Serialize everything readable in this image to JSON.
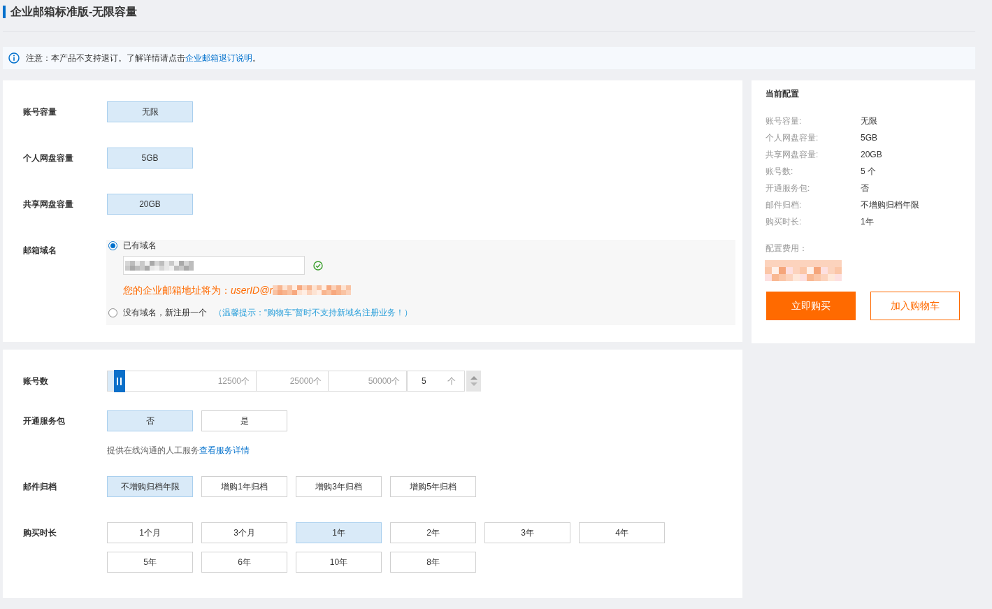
{
  "title": "企业邮箱标准版-无限容量",
  "notice": {
    "text": "注意：本产品不支持退订。了解详情请点击",
    "link": "企业邮箱退订说明",
    "text_after": "。"
  },
  "spec_form": {
    "rows": [
      {
        "kind": "options",
        "label": "账号容量",
        "options": [
          {
            "label": "无限",
            "selected": true
          }
        ]
      },
      {
        "kind": "options",
        "label": "个人网盘容量",
        "options": [
          {
            "label": "5GB",
            "selected": true
          }
        ]
      },
      {
        "kind": "options",
        "label": "共享网盘容量",
        "options": [
          {
            "label": "20GB",
            "selected": true
          }
        ]
      },
      {
        "kind": "domain",
        "label": "邮箱域名",
        "choices": [
          {
            "label": "已有域名",
            "selected": true,
            "verified": true,
            "address_note": "您的企业邮箱地址将为：*userID@r*"
          },
          {
            "label": "没有域名，新注册一个",
            "selected": false,
            "hint": "（温馨提示：“购物车”暂时不支持新域名注册业务！）"
          }
        ]
      }
    ]
  },
  "quantity_form": {
    "rows": [
      {
        "kind": "slider",
        "label": "账号数",
        "level": 0.02,
        "ticks": [
          "12500个",
          "25000个",
          "50000个"
        ],
        "value": "5",
        "unit": "个"
      },
      {
        "kind": "options",
        "label": "开通服务包",
        "options": [
          {
            "label": "否",
            "selected": true
          },
          {
            "label": "是",
            "selected": false
          }
        ],
        "note": {
          "text": "提供在线沟通的人工服务",
          "link": "查看服务详情"
        }
      },
      {
        "kind": "options",
        "label": "邮件归档",
        "options": [
          {
            "label": "不增购归档年限",
            "selected": true
          },
          {
            "label": "增购1年归档",
            "selected": false
          },
          {
            "label": "增购3年归档",
            "selected": false
          },
          {
            "label": "增购5年归档",
            "selected": false
          }
        ]
      },
      {
        "kind": "options",
        "label": "购买时长",
        "options": [
          {
            "label": "1个月",
            "selected": false
          },
          {
            "label": "3个月",
            "selected": false
          },
          {
            "label": "1年",
            "selected": true
          },
          {
            "label": "2年",
            "selected": false
          },
          {
            "label": "3年",
            "selected": false
          },
          {
            "label": "4年",
            "selected": false
          },
          {
            "label": "5年",
            "selected": false
          },
          {
            "label": "6年",
            "selected": false
          },
          {
            "label": "10年",
            "selected": false
          },
          {
            "label": "8年",
            "selected": false
          }
        ]
      }
    ]
  },
  "summary": {
    "title": "当前配置",
    "items": [
      {
        "label": "账号容量:",
        "value": "无限"
      },
      {
        "label": "个人网盘容量:",
        "value": "5GB"
      },
      {
        "label": "共享网盘容量:",
        "value": "20GB"
      },
      {
        "label": "账号数:",
        "value": "5 个"
      },
      {
        "label": "开通服务包:",
        "value": "否"
      },
      {
        "label": "邮件归档:",
        "value": "不增购归档年限"
      },
      {
        "label": "购买时长:",
        "value": "1年"
      }
    ],
    "fee_label": "配置费用：",
    "buttons": [
      {
        "kind": "primary",
        "label": "立即购买"
      },
      {
        "kind": "secondary",
        "label": "加入购物车"
      }
    ]
  }
}
